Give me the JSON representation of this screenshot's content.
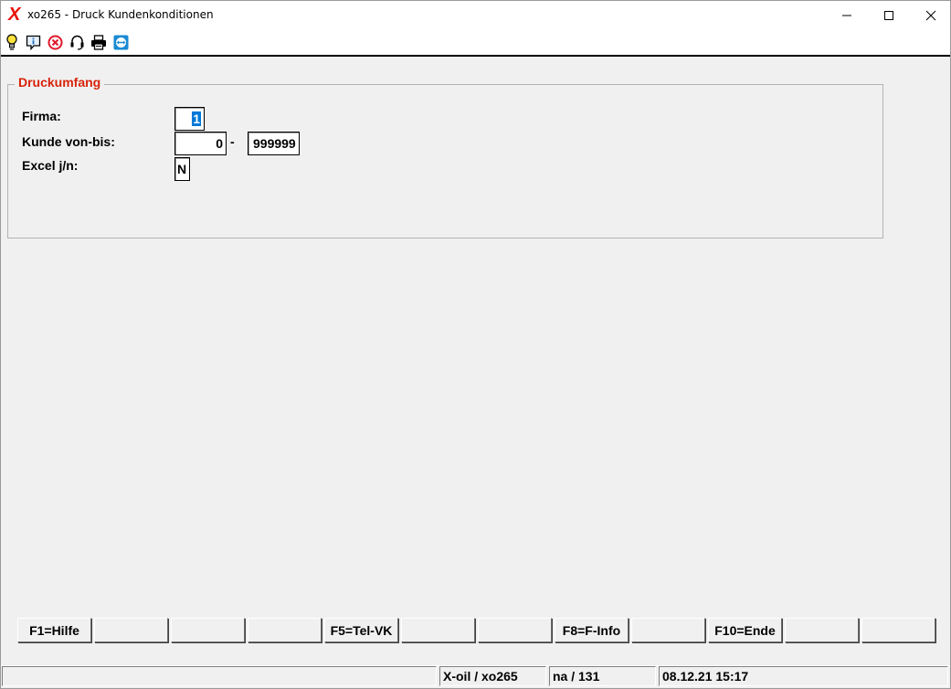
{
  "window": {
    "title": "xo265 - Druck Kundenkonditionen",
    "logo": "X"
  },
  "toolbar": {
    "icons": [
      "lightbulb-icon",
      "info-icon",
      "cancel-icon",
      "headset-icon",
      "printer-icon",
      "teamviewer-icon"
    ]
  },
  "form": {
    "group_title": "Druckumfang",
    "firma_label": "Firma:",
    "firma_value": "1",
    "kunde_label": "Kunde von-bis:",
    "kunde_from": "0",
    "kunde_separator": "-",
    "kunde_to": "999999",
    "excel_label": "Excel j/n:",
    "excel_value": "N"
  },
  "function_keys": [
    "F1=Hilfe",
    "",
    "",
    "",
    "F5=Tel-VK",
    "",
    "",
    "F8=F-Info",
    "",
    "F10=Ende",
    "",
    ""
  ],
  "statusbar": {
    "cell1": "",
    "program": "X-oil / xo265",
    "user": "na / 131",
    "datetime": "08.12.21 15:17"
  },
  "colors": {
    "group_title": "#d8230a",
    "logo": "#e8140c",
    "selection": "#0078d7"
  }
}
